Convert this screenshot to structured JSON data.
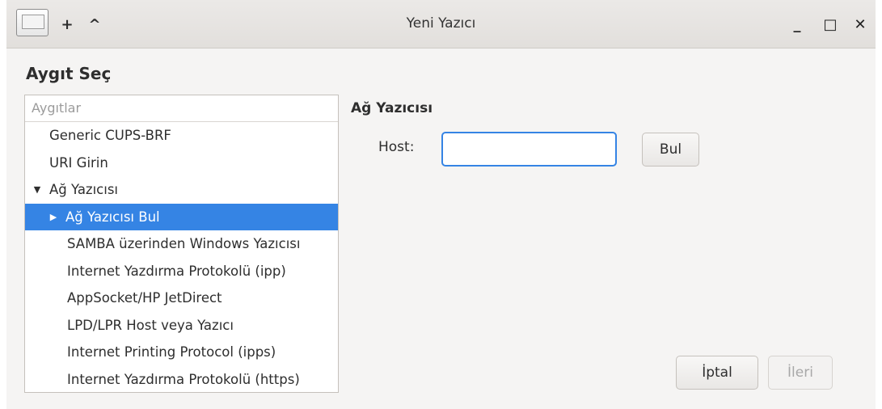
{
  "window": {
    "title": "Yeni Yazıcı",
    "titlebar_buttons": {
      "pin": "+",
      "shade": "^"
    },
    "controls": {
      "minimize": "_",
      "maximize": "□",
      "close": "✕"
    }
  },
  "heading": "Aygıt Seç",
  "tree": {
    "header": "Aygıtlar",
    "items": [
      {
        "label": "Generic CUPS-BRF"
      },
      {
        "label": "URI Girin"
      },
      {
        "label": "Ağ Yazıcısı",
        "expander": "▼"
      },
      {
        "label": "Ağ Yazıcısı Bul",
        "expander": "▶",
        "selected": true
      },
      {
        "label": "SAMBA üzerinden Windows Yazıcısı"
      },
      {
        "label": "Internet Yazdırma Protokolü (ipp)"
      },
      {
        "label": "AppSocket/HP JetDirect"
      },
      {
        "label": "LPD/LPR Host veya Yazıcı"
      },
      {
        "label": "Internet Printing Protocol (ipps)"
      },
      {
        "label": "Internet Yazdırma Protokolü (https)"
      }
    ]
  },
  "panel": {
    "section_title": "Ağ Yazıcısı",
    "host_label": "Host:",
    "host_value": "",
    "find_button": "Bul"
  },
  "footer": {
    "cancel_button": "İptal",
    "next_button": "İleri"
  },
  "colors": {
    "accent": "#3584e4",
    "window_bg": "#f5f4f3"
  }
}
